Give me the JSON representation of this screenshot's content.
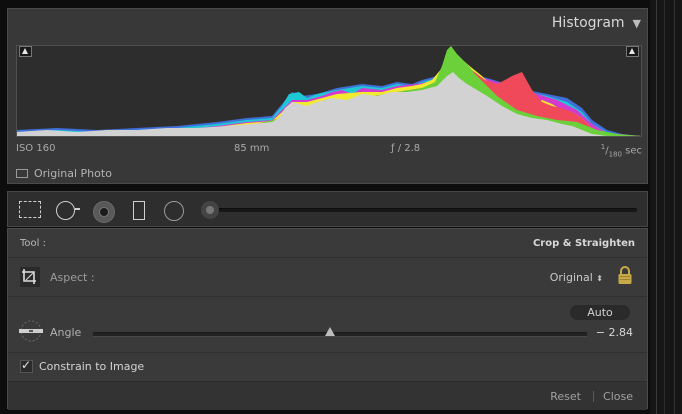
{
  "histogram": {
    "title": "Histogram",
    "collapse_icon": "triangle-down-icon",
    "iso": "ISO 160",
    "focal_length": "85 mm",
    "aperture": "ƒ / 2.8",
    "shutter_num": "1",
    "shutter_den": "180",
    "shutter_unit": "sec",
    "original_photo_label": "Original Photo",
    "colors": {
      "luminance": "#d2d2d2",
      "blue": "#3f6fd8",
      "cyan": "#1ec9d6",
      "magenta": "#d33bd0",
      "yellow": "#f2ea2e",
      "red": "#f04a5a",
      "green": "#6bd03a"
    }
  },
  "tool_strip": {
    "tools": [
      "crop-overlay-icon",
      "spot-removal-icon",
      "red-eye-icon",
      "graduated-filter-icon",
      "radial-filter-icon",
      "adjustment-brush-icon"
    ]
  },
  "crop": {
    "tool_label": "Tool :",
    "tool_value": "Crop & Straighten",
    "aspect_label": "Aspect :",
    "aspect_value": "Original",
    "aspect_stepper_icon": "updown-arrows-icon",
    "lock_icon": "padlock-icon",
    "auto_label": "Auto",
    "angle_label": "Angle",
    "angle_value": "− 2.84",
    "angle_slider_fraction": 0.48,
    "constrain_label": "Constrain to Image",
    "constrain_checked": true,
    "reset_label": "Reset",
    "close_label": "Close"
  }
}
